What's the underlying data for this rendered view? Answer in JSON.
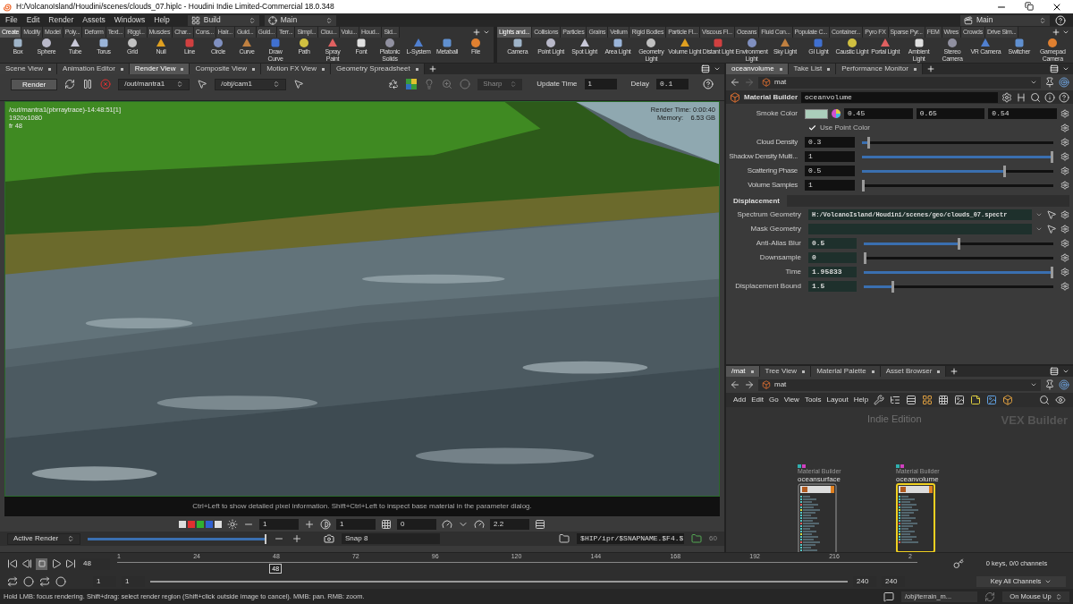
{
  "window": {
    "title": "H:/VolcanoIsland/Houdini/scenes/clouds_07.hiplc - Houdini Indie Limited-Commercial 18.0.348"
  },
  "menu": [
    "File",
    "Edit",
    "Render",
    "Assets",
    "Windows",
    "Help"
  ],
  "desktop": "Build",
  "viewport_layout": "Main",
  "right_desktop": "Main",
  "shelf_left": {
    "tabs": [
      {
        "label": "Create",
        "selected": true
      },
      {
        "label": "Modify",
        "selected": false
      },
      {
        "label": "Model",
        "selected": false
      },
      {
        "label": "Poly...",
        "selected": false
      },
      {
        "label": "Deform",
        "selected": false
      },
      {
        "label": "Text...",
        "selected": false
      },
      {
        "label": "Riggi...",
        "selected": false
      },
      {
        "label": "Muscles",
        "selected": false
      },
      {
        "label": "Char...",
        "selected": false
      },
      {
        "label": "Cons...",
        "selected": false
      },
      {
        "label": "Hair...",
        "selected": false
      },
      {
        "label": "Guid...",
        "selected": false
      },
      {
        "label": "Guid...",
        "selected": false
      },
      {
        "label": "Terr...",
        "selected": false
      },
      {
        "label": "Simpl...",
        "selected": false
      },
      {
        "label": "Clou...",
        "selected": false
      },
      {
        "label": "Volu...",
        "selected": false
      },
      {
        "label": "Houd...",
        "selected": false
      },
      {
        "label": "Sid...",
        "selected": false
      }
    ],
    "tools": [
      "Box",
      "Sphere",
      "Tube",
      "Torus",
      "Grid",
      "Null",
      "Line",
      "Circle",
      "Curve",
      "Draw Curve",
      "Path",
      "Spray Paint",
      "Font",
      "Platonic Solids",
      "L-System",
      "Metaball",
      "File"
    ]
  },
  "shelf_right": {
    "tabs": [
      {
        "label": "Lights and...",
        "selected": true
      },
      {
        "label": "Collisions",
        "selected": false
      },
      {
        "label": "Particles",
        "selected": false
      },
      {
        "label": "Grains",
        "selected": false
      },
      {
        "label": "Vellum",
        "selected": false
      },
      {
        "label": "Rigid Bodies",
        "selected": false
      },
      {
        "label": "Particle Fl...",
        "selected": false
      },
      {
        "label": "Viscous Fl...",
        "selected": false
      },
      {
        "label": "Oceans",
        "selected": false
      },
      {
        "label": "Fluid Con...",
        "selected": false
      },
      {
        "label": "Populate C...",
        "selected": false
      },
      {
        "label": "Container...",
        "selected": false
      },
      {
        "label": "Pyro FX",
        "selected": false
      },
      {
        "label": "Sparse Pyr...",
        "selected": false
      },
      {
        "label": "FEM",
        "selected": false
      },
      {
        "label": "Wires",
        "selected": false
      },
      {
        "label": "Crowds",
        "selected": false
      },
      {
        "label": "Drive Sim...",
        "selected": false
      }
    ],
    "tools": [
      "Camera",
      "Point Light",
      "Spot Light",
      "Area Light",
      "Geometry Light",
      "Volume Light",
      "Distant Light",
      "Environment Light",
      "Sky Light",
      "GI Light",
      "Caustic Light",
      "Portal Light",
      "Ambient Light",
      "Stereo Camera",
      "VR Camera",
      "Switcher",
      "Gamepad Camera"
    ]
  },
  "left_pane": {
    "tabs": [
      {
        "label": "Scene View",
        "selected": false
      },
      {
        "label": "Animation Editor",
        "selected": false
      },
      {
        "label": "Render View",
        "selected": true
      },
      {
        "label": "Composite View",
        "selected": false
      },
      {
        "label": "Motion FX View",
        "selected": false
      },
      {
        "label": "Geometry Spreadsheet",
        "selected": false
      }
    ],
    "render_button": "Render",
    "rop": "/out/mantra1",
    "camera": "/obj/cam1",
    "filter": "Sharp",
    "update_time_label": "Update Time",
    "update_time": "1",
    "delay_label": "Delay",
    "delay": "0.1",
    "overlay_left": [
      "/out/mantra1(pbrraytrace)-14:48:51[1]",
      "1920x1080",
      "fr 48"
    ],
    "overlay_right": [
      "Render Time: 0:00:40",
      "Memory:    6.53 GB"
    ],
    "caption": "Ctrl+Left to show detailed pixel information. Shift+Ctrl+Left to inspect base material in the parameter dialog.",
    "toolbar_values": [
      "1",
      "1",
      "0",
      "2.2"
    ],
    "snapshot_mode": "Active Render",
    "snapshot_slider": {
      "level": 1
    },
    "snap_label": "Snap 8",
    "snapshot_path": "$HIP/ipr/$SNAPNAME.$F4.$",
    "snapshot_count": "60"
  },
  "parameters": {
    "tabs": [
      {
        "label": "oceanvolume",
        "selected": true
      },
      {
        "label": "Take List",
        "selected": false
      },
      {
        "label": "Performance Monitor",
        "selected": false
      }
    ],
    "path": "mat",
    "node_type": "Material Builder",
    "node_name": "oceanvolume",
    "smoke_color": {
      "label": "Smoke Color",
      "values": [
        "0.45",
        "0.65",
        "0.54"
      ]
    },
    "use_point_color": {
      "label": "Use Point Color",
      "checked": true
    },
    "rows": [
      {
        "label": "Cloud Density",
        "value": "0.3",
        "level": 0.03
      },
      {
        "label": "Shadow Density Multi...",
        "value": "1",
        "level": 1
      },
      {
        "label": "Scattering Phase",
        "value": "0.5",
        "level": 0.75
      },
      {
        "label": "Volume Samples",
        "value": "1",
        "level": 0
      }
    ],
    "section": "Displacement",
    "files": [
      {
        "label": "Spectrum Geometry",
        "value": "H:/VolcanoIsland/Houdini/scenes/geo/clouds_07.spectr"
      },
      {
        "label": "Mask Geometry"
      }
    ],
    "section_rows": [
      {
        "label": "Anti-Alias Blur",
        "value": "0.5",
        "level": 0.5
      },
      {
        "label": "Downsample",
        "value": "0",
        "level": 0
      },
      {
        "label": "Time",
        "value": "1.95833",
        "level": 1
      },
      {
        "label": "Displacement Bound",
        "value": "1.5",
        "level": 0.15
      }
    ]
  },
  "network": {
    "tabs": [
      {
        "label": "/mat",
        "selected": true
      },
      {
        "label": "Tree View",
        "selected": false
      },
      {
        "label": "Material Palette",
        "selected": false
      },
      {
        "label": "Asset Browser",
        "selected": false
      }
    ],
    "path": "mat",
    "menu": [
      "Add",
      "Edit",
      "Go",
      "View",
      "Tools",
      "Layout",
      "Help"
    ],
    "watermark": "Indie Edition",
    "context": "VEX Builder",
    "nodes": [
      {
        "type": "Material Builder",
        "name": "oceansurface",
        "selected": false,
        "kind": "tall"
      },
      {
        "type": "Material Builder",
        "name": "oceanvolume",
        "selected": true,
        "kind": "short"
      }
    ]
  },
  "timeline": {
    "frame": "48",
    "ticks": [
      "1",
      "24",
      "48",
      "72",
      "96",
      "120",
      "144",
      "168",
      "192",
      "216",
      "2"
    ],
    "playhead": {
      "label": "48",
      "level": 0.197
    },
    "keys": "0 keys, 0/0 channels",
    "range_start": "1",
    "playback_start": "1",
    "playback_end": "240",
    "range_end": "240",
    "key_button": "Key All Channels"
  },
  "status_bar": {
    "message": "Hold LMB: focus rendering. Shift+drag: select render region (Shift+click outside image to cancel). MMB: pan. RMB: zoom.",
    "context": "/obj/terrain_m...",
    "update_mode": "On Mouse Up"
  }
}
